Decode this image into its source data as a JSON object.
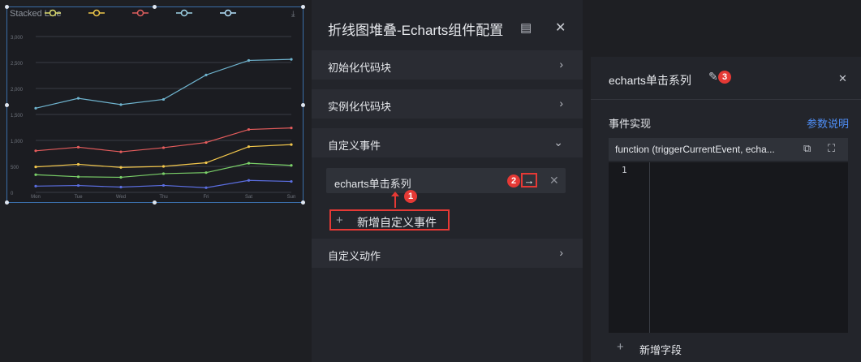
{
  "chart": {
    "title": "Stacked Line",
    "legend_colors": [
      "#d9d96b",
      "#f0c84a",
      "#e05f5f",
      "#9fd4e8",
      "#b7e4ff"
    ],
    "y_ticks": [
      "3,000",
      "2,500",
      "2,000",
      "1,500",
      "1,000",
      "500",
      "0"
    ],
    "x_ticks": [
      "Mon",
      "Tue",
      "Wed",
      "Thu",
      "Fri",
      "Sat",
      "Sun"
    ]
  },
  "chart_data": {
    "type": "line",
    "title": "Stacked Line",
    "categories": [
      "Mon",
      "Tue",
      "Wed",
      "Thu",
      "Fri",
      "Sat",
      "Sun"
    ],
    "ylim": [
      0,
      3000
    ],
    "series": [
      {
        "color": "#5b6ee1",
        "values": [
          120,
          132,
          101,
          134,
          90,
          230,
          210
        ]
      },
      {
        "color": "#7bd169",
        "values": [
          340,
          300,
          290,
          360,
          380,
          560,
          520
        ]
      },
      {
        "color": "#f3c74c",
        "values": [
          490,
          540,
          480,
          500,
          570,
          880,
          920
        ]
      },
      {
        "color": "#e45c5c",
        "values": [
          800,
          870,
          780,
          860,
          960,
          1210,
          1240
        ]
      },
      {
        "color": "#6fb4cf",
        "values": [
          1620,
          1810,
          1690,
          1790,
          2260,
          2540,
          2560
        ]
      }
    ]
  },
  "config": {
    "title": "折线图堆叠-Echarts组件配置",
    "rows": {
      "init": "初始化代码块",
      "instance": "实例化代码块",
      "custom_event": "自定义事件",
      "custom_action": "自定义动作"
    },
    "event_item": "echarts单击系列",
    "add_event": "新增自定义事件",
    "badges": {
      "one": "1",
      "two": "2",
      "three": "3"
    }
  },
  "events_panel": {
    "title": "echarts单击系列",
    "section_label": "事件实现",
    "param_link": "参数说明",
    "code_header": "function (triggerCurrentEvent, echa...",
    "line_number": "1",
    "add_field": "新增字段"
  }
}
